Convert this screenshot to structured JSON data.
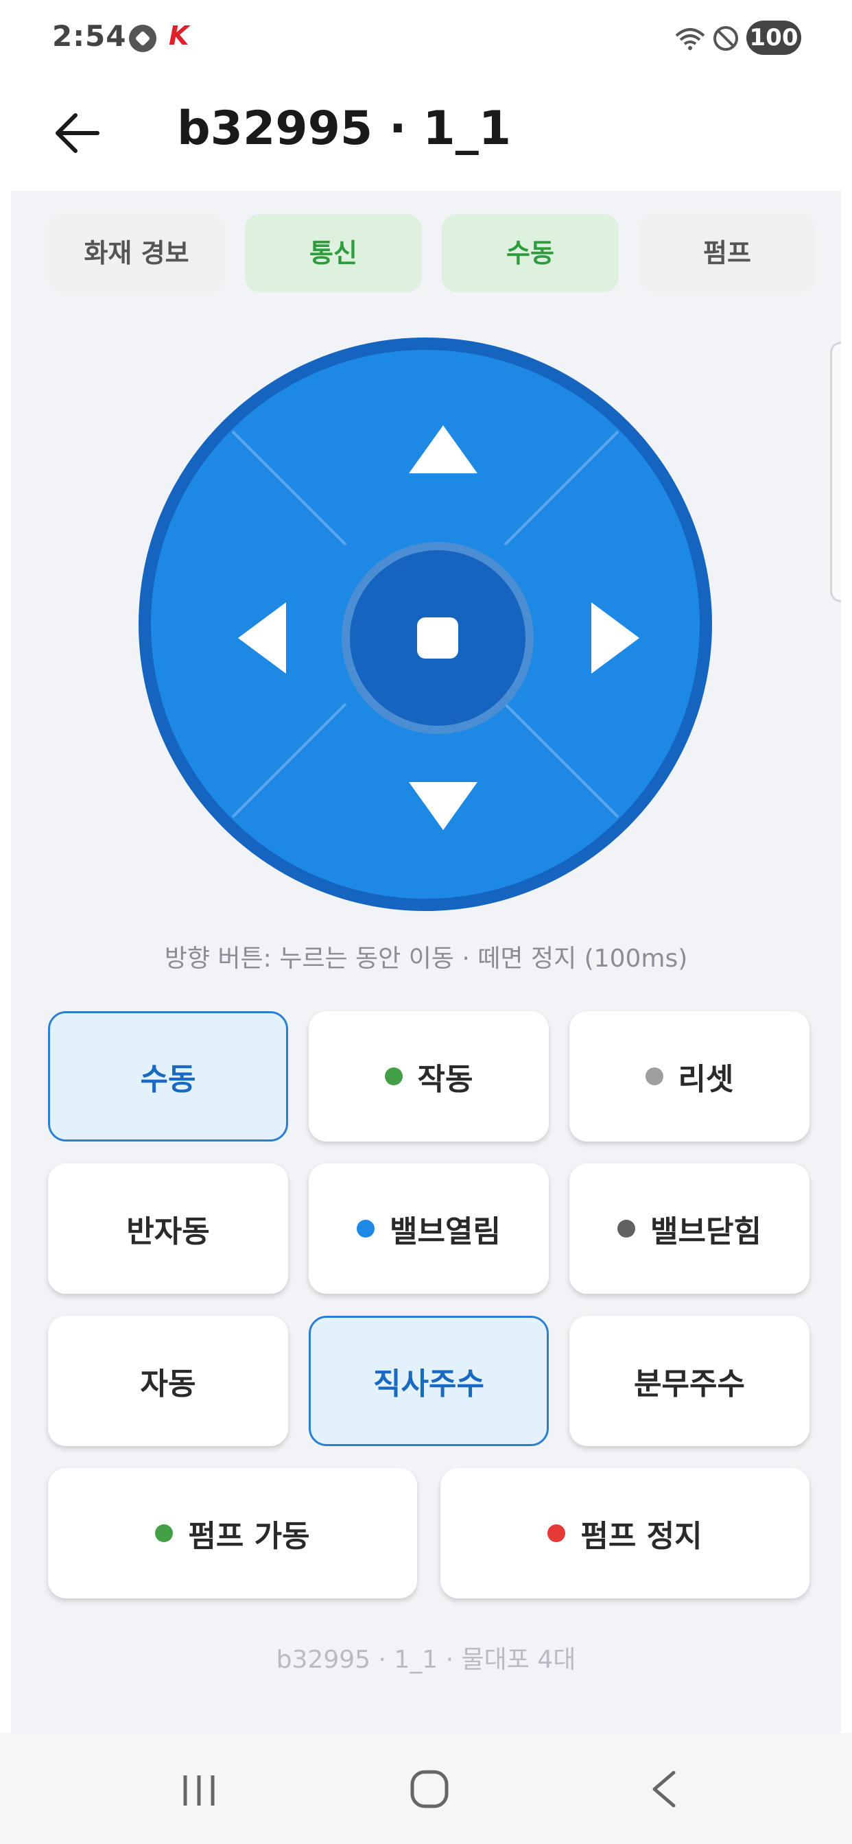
{
  "status": {
    "time": "2:54",
    "battery": "100",
    "k_letter": "K"
  },
  "header": {
    "title": "b32995 · 1_1"
  },
  "tabs": [
    {
      "label": "화재 경보",
      "active": false
    },
    {
      "label": "통신",
      "active": true
    },
    {
      "label": "수동",
      "active": true
    },
    {
      "label": "펌프",
      "active": false
    }
  ],
  "dpad": {
    "hint": "방향 버튼: 누르는 동안 이동 · 떼면 정지 (100ms)"
  },
  "buttons": {
    "manual": "수동",
    "operate": "작동",
    "reset": "리셋",
    "semi_auto": "반자동",
    "valve_open": "밸브열림",
    "valve_close": "밸브닫힘",
    "auto": "자동",
    "direct_spray": "직사주수",
    "fog_spray": "분무주수",
    "pump_start": "펌프 가동",
    "pump_stop": "펌프 정지"
  },
  "colors": {
    "dot_green": "#43a047",
    "dot_gray": "#9e9e9e",
    "dot_blue": "#1e88e5",
    "dot_dark": "#616161",
    "dot_red": "#e53935",
    "accent": "#1e88e5"
  },
  "footer": {
    "note": "b32995 · 1_1 · 물대포 4대"
  }
}
